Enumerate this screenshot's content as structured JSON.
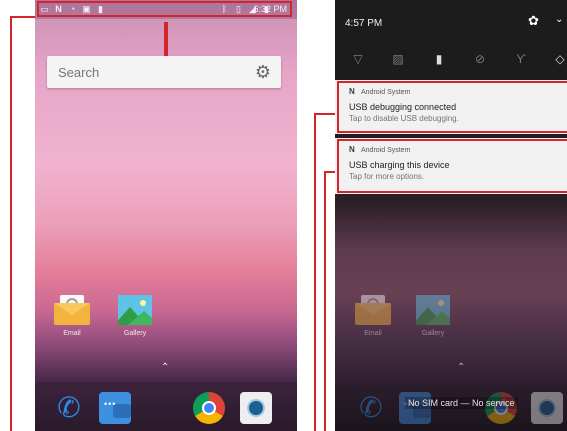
{
  "left_phone": {
    "status_bar": {
      "time": "6:32 PM",
      "icons": [
        "sim-icon",
        "nfc-icon",
        "wifi-icon",
        "image-icon",
        "sd-card-icon",
        "bluetooth-icon",
        "vibrate-icon",
        "signal-icon",
        "battery-icon"
      ]
    },
    "search": {
      "placeholder": "Search"
    },
    "apps": [
      {
        "label": "Email",
        "icon": "email-icon"
      },
      {
        "label": "Gallery",
        "icon": "gallery-icon"
      }
    ],
    "dock": [
      "phone-icon",
      "messaging-icon",
      "chrome-icon",
      "camera-icon"
    ]
  },
  "right_phone": {
    "time": "4:57 PM",
    "quick_settings_icons": [
      "wifi-off-icon",
      "no-sim-icon",
      "battery-saver-icon",
      "do-not-disturb-icon",
      "flashlight-icon",
      "auto-rotate-icon"
    ],
    "notifications": [
      {
        "app": "Android System",
        "title": "USB debugging connected",
        "subtitle": "Tap to disable USB debugging."
      },
      {
        "app": "Android System",
        "title": "USB charging this device",
        "subtitle": "Tap for more options."
      }
    ],
    "apps": [
      {
        "label": "Email"
      },
      {
        "label": "Gallery"
      }
    ],
    "sim_status": "No SIM card — No service"
  },
  "colors": {
    "callout": "#d4242c",
    "notification_bg": "#f1f1f1"
  }
}
